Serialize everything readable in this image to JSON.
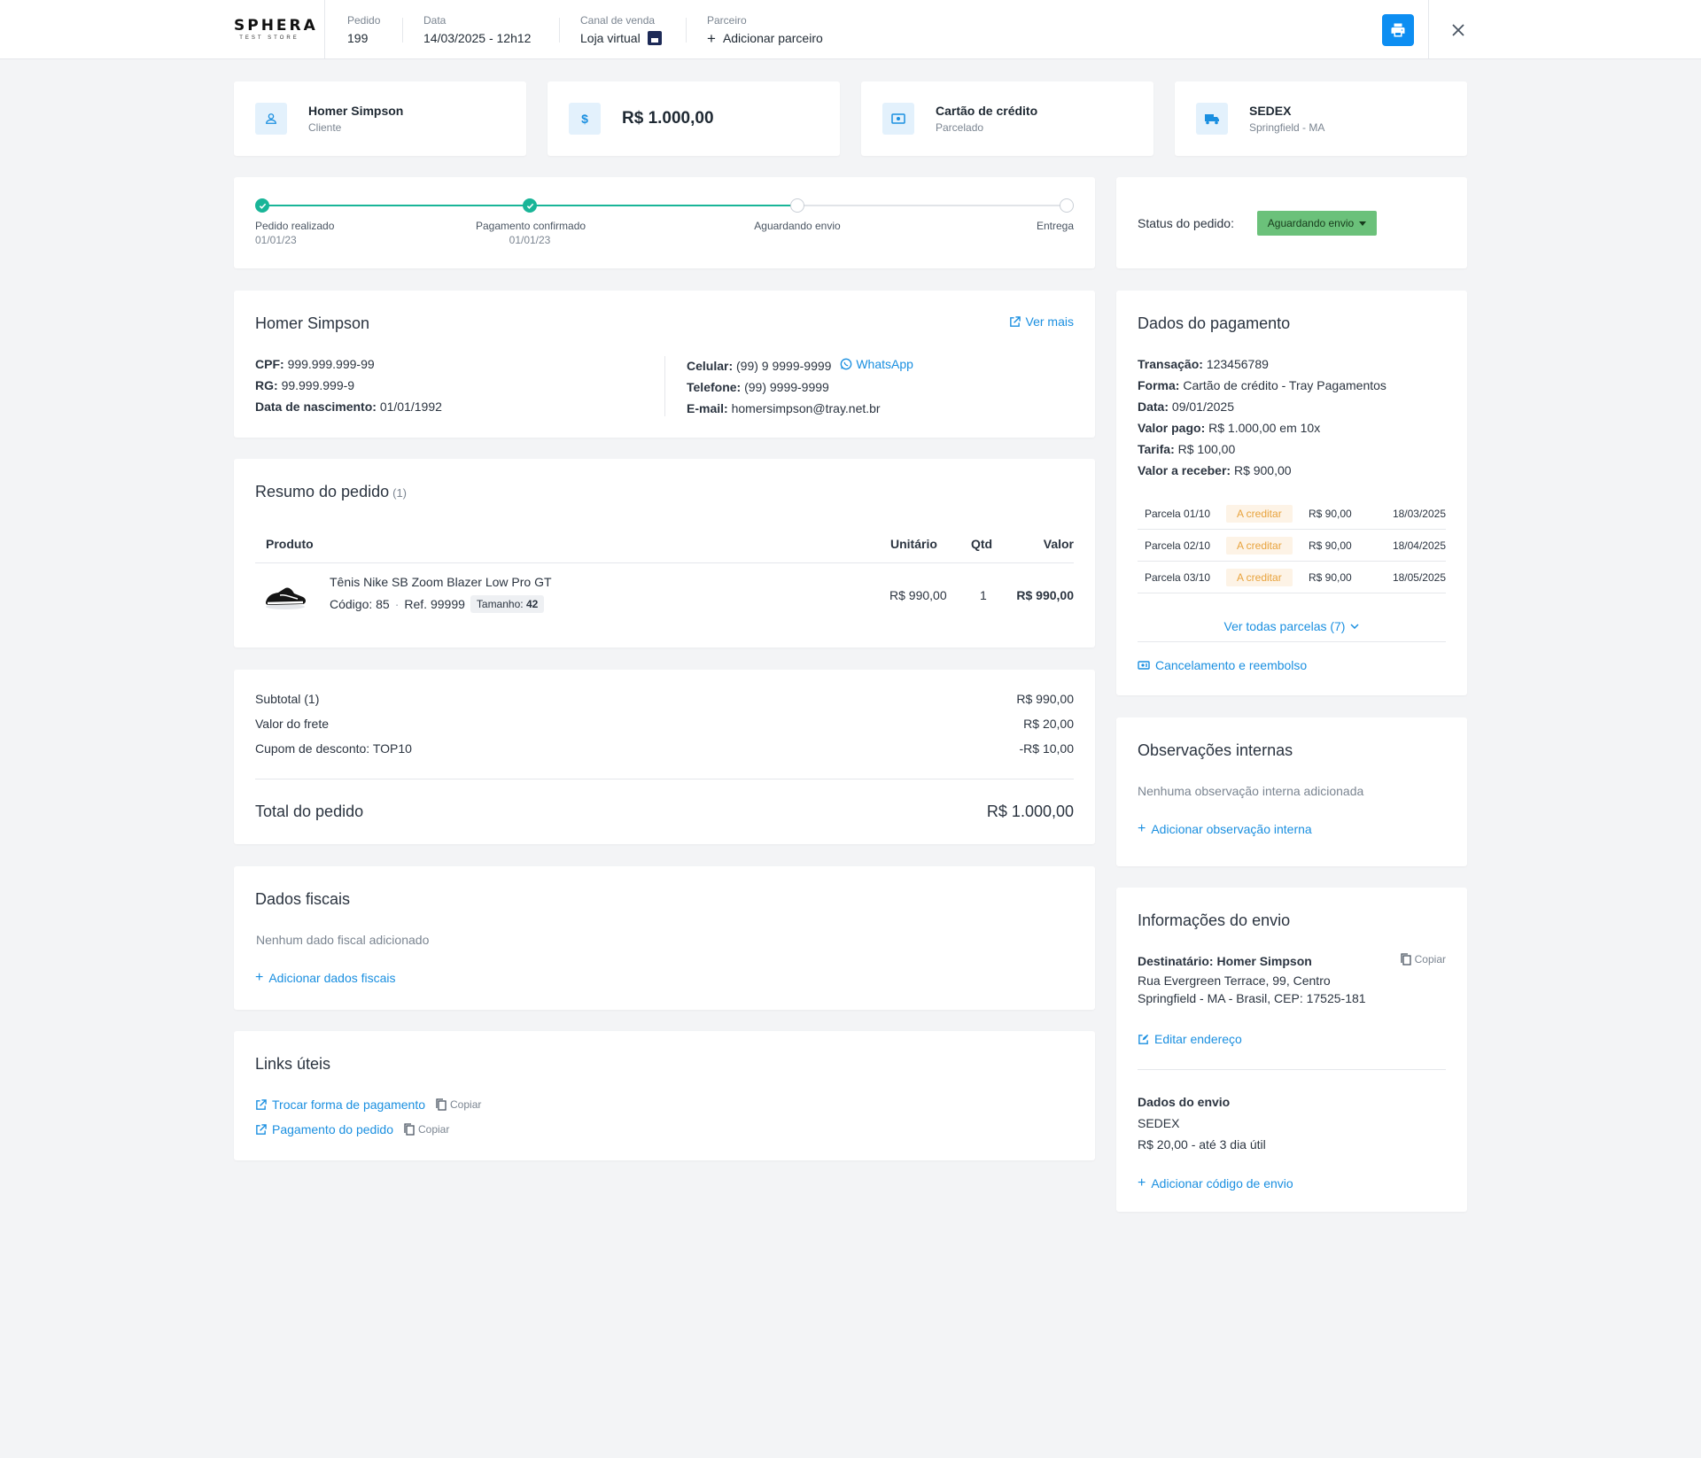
{
  "header": {
    "logo_text": "SPHERA",
    "logo_sub": "TEST STORE",
    "order_label": "Pedido",
    "order_value": "199",
    "date_label": "Data",
    "date_value": "14/03/2025 - 12h12",
    "channel_label": "Canal de venda",
    "channel_value": "Loja virtual",
    "partner_label": "Parceiro",
    "partner_action": "Adicionar parceiro"
  },
  "summary_cards": {
    "customer": {
      "title": "Homer Simpson",
      "subtitle": "Cliente"
    },
    "amount": {
      "title": "R$ 1.000,00"
    },
    "payment": {
      "title": "Cartão de crédito",
      "subtitle": "Parcelado"
    },
    "shipping": {
      "title": "SEDEX",
      "subtitle": "Springfield  - MA"
    }
  },
  "stepper": {
    "steps": [
      {
        "label": "Pedido realizado",
        "date": "01/01/23",
        "done": true
      },
      {
        "label": "Pagamento confirmado",
        "date": "01/01/23",
        "done": true
      },
      {
        "label": "Aguardando envio",
        "date": "",
        "done": false
      },
      {
        "label": "Entrega",
        "date": "",
        "done": false
      }
    ]
  },
  "status": {
    "label": "Status do pedido:",
    "value": "Aguardando envio",
    "color": "#6bc17a"
  },
  "customer": {
    "name": "Homer Simpson",
    "more_link": "Ver mais",
    "cpf_label": "CPF:",
    "cpf": "999.999.999-99",
    "rg_label": "RG:",
    "rg": "99.999.999-9",
    "birth_label": "Data de nascimento:",
    "birth": "01/01/1992",
    "cell_label": "Celular:",
    "cell": "(99) 9 9999-9999",
    "whatsapp": "WhatsApp",
    "phone_label": "Telefone:",
    "phone": "(99) 9999-9999",
    "email_label": "E-mail:",
    "email": "homersimpson@tray.net.br"
  },
  "order": {
    "title": "Resumo do pedido",
    "count": "(1)",
    "columns": {
      "product": "Produto",
      "unit": "Unitário",
      "qty": "Qtd",
      "value": "Valor"
    },
    "items": [
      {
        "name": "Tênis Nike SB Zoom Blazer Low Pro GT",
        "code": "Código: 85",
        "ref": "Ref. 99999",
        "size_label": "Tamanho:",
        "size": "42",
        "unit": "R$ 990,00",
        "qty": "1",
        "value": "R$ 990,00"
      }
    ]
  },
  "totals": {
    "subtotal_label": "Subtotal (1)",
    "subtotal": "R$ 990,00",
    "shipping_label": "Valor do frete",
    "shipping": "R$ 20,00",
    "coupon_label": "Cupom de desconto: TOP10",
    "coupon": "-R$ 10,00",
    "total_label": "Total do pedido",
    "total": "R$ 1.000,00"
  },
  "fiscal": {
    "title": "Dados fiscais",
    "empty": "Nenhum dado fiscal adicionado",
    "add": "Adicionar dados fiscais"
  },
  "links": {
    "title": "Links úteis",
    "items": [
      {
        "label": "Trocar forma de pagamento",
        "copy": "Copiar"
      },
      {
        "label": "Pagamento do pedido",
        "copy": "Copiar"
      }
    ]
  },
  "payment": {
    "title": "Dados do pagamento",
    "transaction_label": "Transação:",
    "transaction": "123456789",
    "method_label": "Forma:",
    "method": "Cartão de crédito - Tray Pagamentos",
    "date_label": "Data:",
    "date": "09/01/2025",
    "paid_label": "Valor pago:",
    "paid": "R$ 1.000,00 em 10x",
    "fee_label": "Tarifa:",
    "fee": "R$ 100,00",
    "receive_label": "Valor a receber:",
    "receive": "R$ 900,00",
    "installments": [
      {
        "label": "Parcela 01/10",
        "status": "A creditar",
        "value": "R$ 90,00",
        "date": "18/03/2025"
      },
      {
        "label": "Parcela 02/10",
        "status": "A creditar",
        "value": "R$ 90,00",
        "date": "18/04/2025"
      },
      {
        "label": "Parcela 03/10",
        "status": "A creditar",
        "value": "R$ 90,00",
        "date": "18/05/2025"
      }
    ],
    "see_all": "Ver todas parcelas (7)",
    "cancel": "Cancelamento e reembolso"
  },
  "observations": {
    "title": "Observações internas",
    "empty": "Nenhuma observação interna adicionada",
    "add": "Adicionar observação interna"
  },
  "shipping": {
    "title": "Informações do envio",
    "recipient": "Destinatário: Homer Simpson",
    "copy": "Copiar",
    "address1": "Rua Evergreen Terrace, 99, Centro",
    "address2": "Springfield  - MA - Brasil, CEP: 17525-181",
    "edit": "Editar endereço",
    "data_title": "Dados do envio",
    "carrier": "SEDEX",
    "price": "R$ 20,00 - até 3 dia útil",
    "add_code": "Adicionar código de envio"
  },
  "colors": {
    "accent": "#1a8fe0",
    "primary_button": "#0d8ef2",
    "step_done": "#19b598",
    "status_pill": "#6bc17a",
    "badge_text": "#e8a33d"
  }
}
